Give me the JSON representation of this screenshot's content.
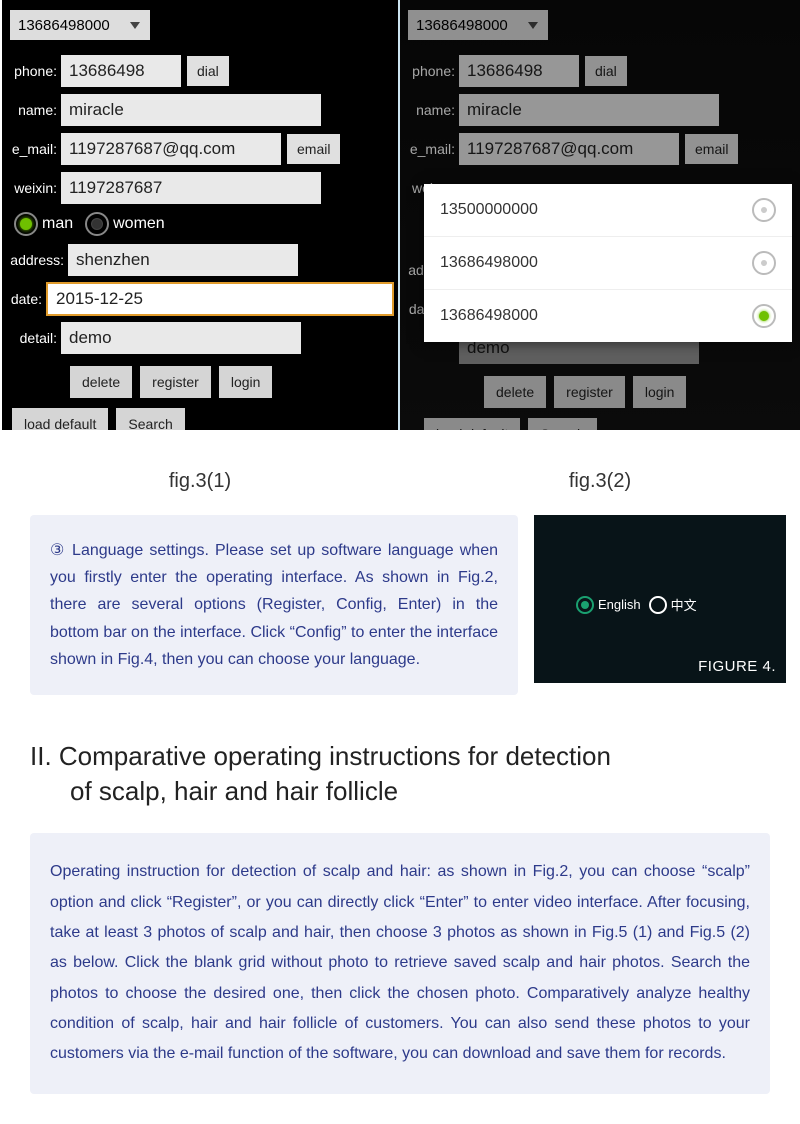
{
  "fig3_1": {
    "dropdown_value": "13686498000",
    "phone_label": "phone:",
    "phone_value": "13686498",
    "dial_label": "dial",
    "name_label": "name:",
    "name_value": "miracle",
    "email_label": "e_mail:",
    "email_value": "1197287687@qq.com",
    "email_btn": "email",
    "weixin_label": "weixin:",
    "weixin_value": "1197287687",
    "man_label": "man",
    "women_label": "women",
    "address_label": "address:",
    "address_value": "shenzhen",
    "date_label": "date:",
    "date_value": "2015-12-25",
    "detail_label": "detail:",
    "detail_value": "demo",
    "delete_label": "delete",
    "register_label": "register",
    "login_label": "login",
    "load_default_label": "load default",
    "search_label": "Search"
  },
  "fig3_2": {
    "dropdown_value": "13686498000",
    "phone_label": "phone:",
    "phone_value": "13686498",
    "dial_label": "dial",
    "name_label": "name:",
    "name_value": "miracle",
    "email_label": "e_mail:",
    "email_value": "1197287687@qq.com",
    "email_btn": "email",
    "weixin_label": "weix",
    "address_label": "addre",
    "date_label": "date:",
    "detail_value": "demo",
    "popup": {
      "opt0": "13500000000",
      "opt1": "13686498000",
      "opt2": "13686498000"
    },
    "delete_label": "delete",
    "register_label": "register",
    "login_label": "login",
    "load_default_label": "load default",
    "search_label": "Search"
  },
  "captions": {
    "fig31": "fig.3(1)",
    "fig32": "fig.3(2)"
  },
  "lang_block": {
    "text": "③ Language settings. Please set up software language when you firstly enter the operating interface. As shown in Fig.2, there are several options (Register, Config, Enter) in the bottom bar on the interface. Click “Config” to enter the interface shown in Fig.4, then you can choose your language."
  },
  "fig4": {
    "english": "English",
    "chinese": "中文",
    "caption": "FIGURE 4."
  },
  "section2_title_line1": "II. Comparative operating instructions for detection",
  "section2_title_line2": "of scalp, hair and hair follicle",
  "section2_body": "Operating instruction for detection of scalp and hair: as shown in Fig.2, you can choose “scalp” option and click “Register”, or you can directly click “Enter” to enter video interface. After focusing, take at least 3 photos of scalp and hair, then choose 3 photos as shown in Fig.5 (1) and Fig.5 (2) as below. Click the blank grid without photo to retrieve saved scalp and hair photos. Search the photos to choose the desired one, then click the chosen photo. Comparatively analyze healthy condition of scalp, hair and hair follicle of customers. You can also send these photos to your customers via the e-mail function of the software, you can download and save them for records."
}
